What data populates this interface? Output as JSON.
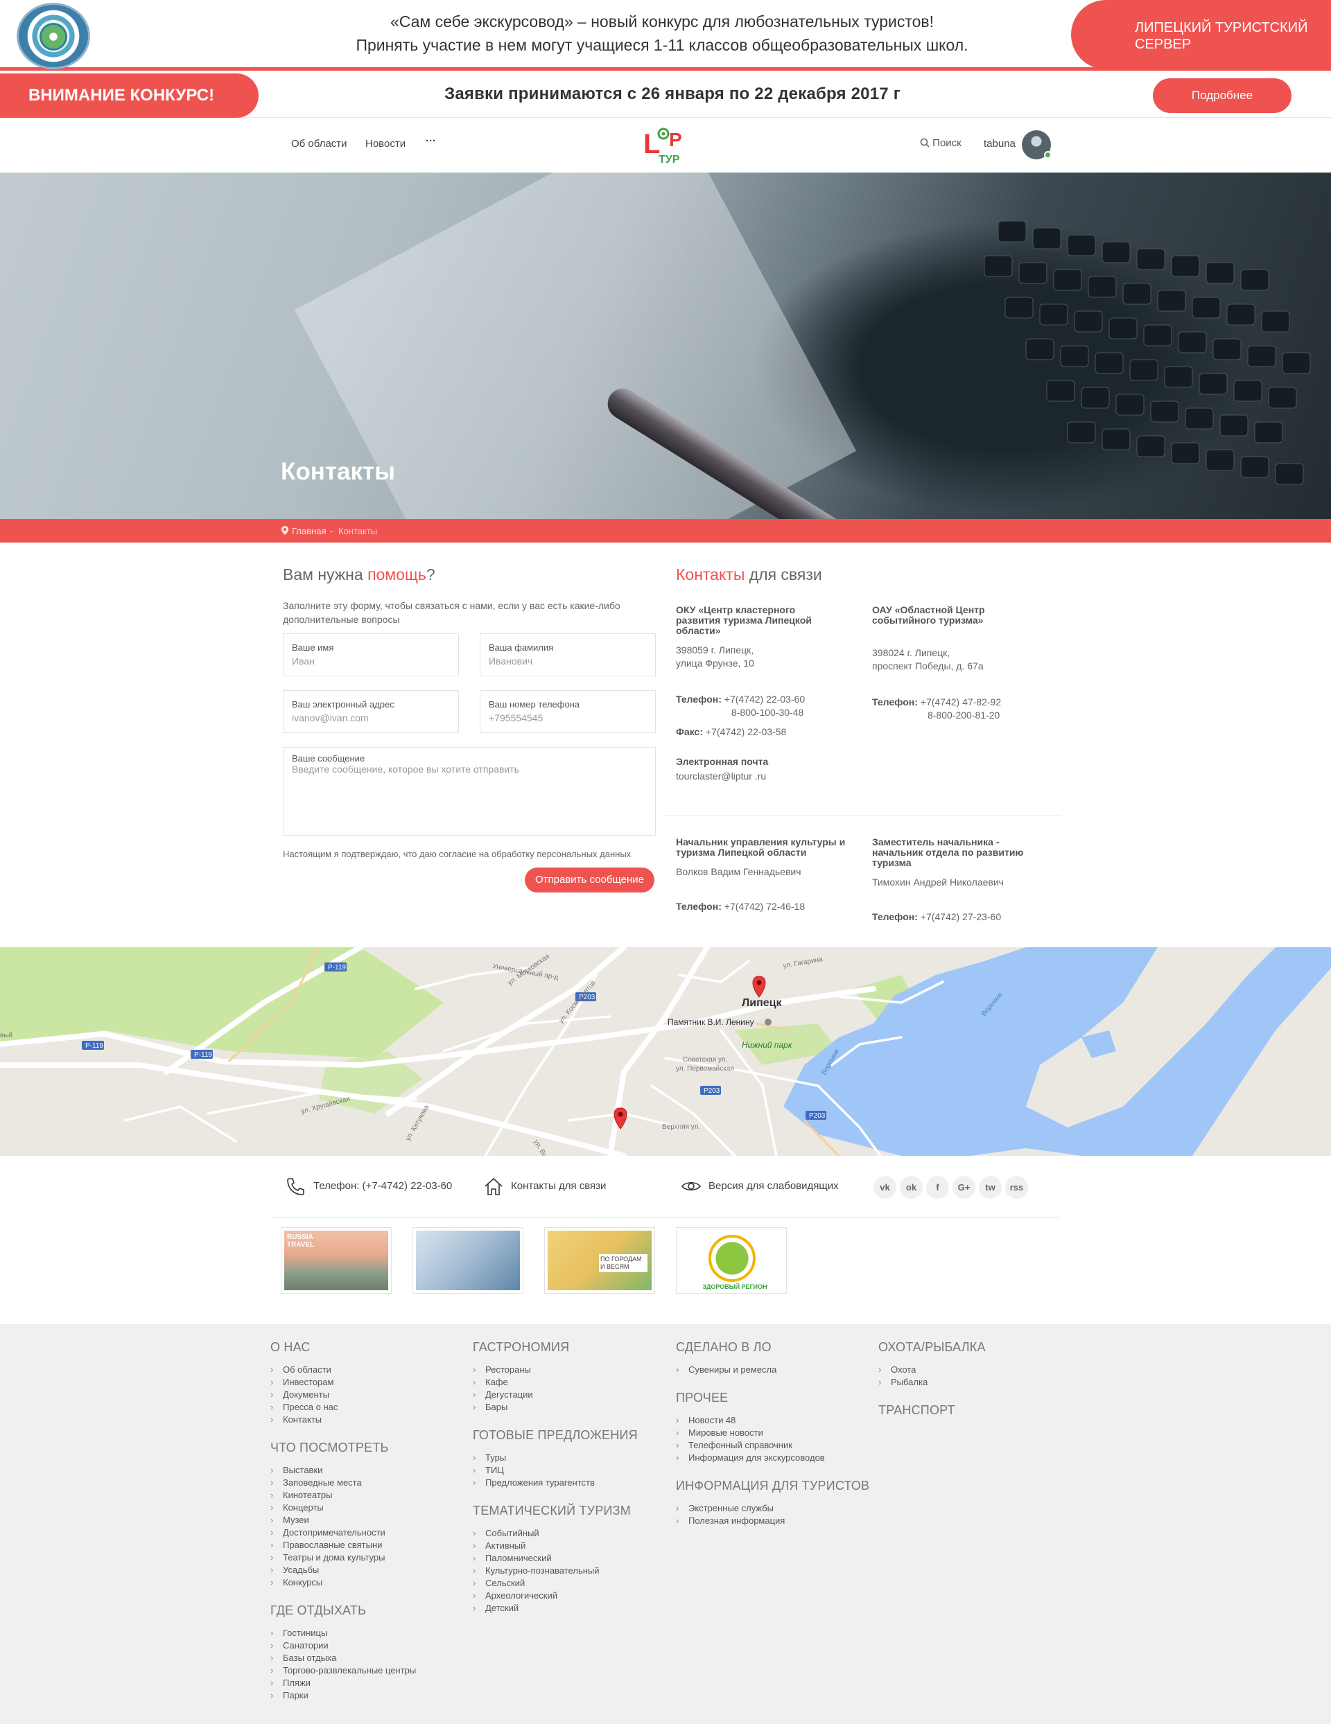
{
  "promo": {
    "line1": "«Сам себе экскурсовод» – новый конкурс для любознательных туристов!",
    "line2": "Принять участие в нем могут учащиеся 1-11 классов общеобразовательных школ.",
    "server_label": "ЛИПЕЦКИЙ ТУРИСТСКИЙ СЕРВЕР"
  },
  "contest": {
    "badge": "ВНИМАНИЕ КОНКУРС!",
    "text": "Заявки принимаются с 26 января по 22 декабря 2017 г",
    "button": "Подробнее"
  },
  "nav": {
    "items": [
      "Об области",
      "Новости"
    ],
    "more": "···",
    "search": "Поиск",
    "user": "tabuna",
    "logo_text": "ТУР"
  },
  "hero": {
    "title": "Контакты"
  },
  "breadcrumb": {
    "home": "Главная",
    "sep": "-",
    "current": "Контакты"
  },
  "form": {
    "title_pre": "Вам нужна ",
    "title_accent": "помощь",
    "title_post": "?",
    "description": "Заполните эту форму, чтобы связаться с нами, если у вас есть какие-либо дополнительные вопросы",
    "fields": [
      {
        "label": "Ваше имя",
        "placeholder": "Иван"
      },
      {
        "label": "Ваша фамилия",
        "placeholder": "Иванович"
      },
      {
        "label": "Ваш электронный адрес",
        "placeholder": "ivanov@ivan.com"
      },
      {
        "label": "Ваш номер телефона",
        "placeholder": "+795554545"
      },
      {
        "label": "Ваше сообщение",
        "placeholder": "Введите сообщение, которое вы хотите отправить"
      }
    ],
    "consent": "Настоящим я подтверждаю, что даю согласие на обработку персональных данных",
    "submit": "Отправить сообщение"
  },
  "contacts": {
    "title_accent": "Контакты",
    "title_post": " для связи",
    "org1": {
      "name": "ОКУ «Центр кластерного развития туризма Липецкой области»",
      "address1": "398059 г. Липецк,",
      "address2": "улица Фрунзе, 10",
      "phone_label": "Телефон:",
      "phone1": "+7(4742) 22-03-60",
      "phone2": "8-800-100-30-48",
      "fax_label": "Факс:",
      "fax": "+7(4742) 22-03-58",
      "email_label": "Электронная почта",
      "email": "tourclaster@liptur .ru"
    },
    "org2": {
      "name": "ОАУ «Областной Центр событийного туризма»",
      "address1": "398024 г. Липецк,",
      "address2": "проспект Победы, д. 67а",
      "phone_label": "Телефон:",
      "phone1": "+7(4742) 47-82-92",
      "phone2": "8-800-200-81-20"
    },
    "person1": {
      "title": "Начальник управления культуры и туризма Липецкой области",
      "name": "Волков Вадим Геннадьевич",
      "phone_label": "Телефон:",
      "phone": "+7(4742) 72-46-18"
    },
    "person2": {
      "title": "Заместитель начальника - начальник отдела по развитию туризма",
      "name": "Тимохин Андрей Николаевич",
      "phone_label": "Телефон:",
      "phone": "+7(4742) 27-23-60"
    }
  },
  "map": {
    "city": "Липецк",
    "monument": "Памятник В.И. Ленину",
    "park": "Нижний парк",
    "roads": [
      "Р-119",
      "Р-119",
      "Р-119",
      "Р203",
      "Р203",
      "Р203"
    ],
    "edge_label": "вый",
    "streets": [
      "ул. Московская",
      "ул. Космонавтов",
      "ул. Гагарина",
      "Советская ул.",
      "ул. Первомайская",
      "Универсальный пр-д",
      "Воронеж",
      "Воронеж",
      "ул. Катукова",
      "Верхняя ул.",
      "ул. Ворошилова",
      "ул. Хрущёвская"
    ]
  },
  "footer": {
    "phone": "Телефон: (+7-4742) 22-03-60",
    "contacts": "Контакты для связи",
    "accessibility": "Версия для слабовидящих",
    "social": [
      "vk",
      "ok",
      "f",
      "G+",
      "tw",
      "rss"
    ],
    "banner_labels": [
      "RUSSIA TRAVEL",
      "ПО ГОРОДАМ И ВЕСЯМ",
      "ЗДОРОВЫЙ РЕГИОН"
    ]
  },
  "sitemap": {
    "col1": [
      {
        "title": "О НАС",
        "items": [
          "Об области",
          "Инвесторам",
          "Документы",
          "Пресса о нас",
          "Контакты"
        ]
      },
      {
        "title": "ЧТО ПОСМОТРЕТЬ",
        "items": [
          "Выставки",
          "Заповедные места",
          "Кинотеатры",
          "Концерты",
          "Музеи",
          "Достопримечательности",
          "Православные святыни",
          "Театры и дома культуры",
          "Усадьбы",
          "Конкурсы"
        ]
      },
      {
        "title": "ГДЕ ОТДЫХАТЬ",
        "items": [
          "Гостиницы",
          "Санатории",
          "Базы отдыха",
          "Торгово-развлекальные центры",
          "Пляжи",
          "Парки"
        ]
      }
    ],
    "col2": [
      {
        "title": "ГАСТРОНОМИЯ",
        "items": [
          "Рестораны",
          "Кафе",
          "Дегустации",
          "Бары"
        ]
      },
      {
        "title": "ГОТОВЫЕ ПРЕДЛОЖЕНИЯ",
        "items": [
          "Туры",
          "ТИЦ",
          "Предложения турагентств"
        ]
      },
      {
        "title": "ТЕМАТИЧЕСКИЙ ТУРИЗМ",
        "items": [
          "Событийный",
          "Активный",
          "Паломнический",
          "Культурно-познавательный",
          "Сельский",
          "Археологический",
          "Детский"
        ]
      }
    ],
    "col3": [
      {
        "title": "СДЕЛАНО В ЛО",
        "items": [
          "Сувениры и ремесла"
        ]
      },
      {
        "title": "ПРОЧЕЕ",
        "items": [
          "Новости 48",
          "Мировые новости",
          "Телефонный справочник",
          "Информация для экскурсоводов"
        ]
      },
      {
        "title": "ИНФОРМАЦИЯ ДЛЯ ТУРИСТОВ",
        "items": [
          "Экстренные службы",
          "Полезная информация"
        ]
      }
    ],
    "col4": [
      {
        "title": "ОХОТА/РЫБАЛКА",
        "items": [
          "Охота",
          "Рыбалка"
        ]
      },
      {
        "title": "ТРАНСПОРТ",
        "items": []
      }
    ]
  },
  "colors": {
    "accent": "#ef5350",
    "footer_bg": "#eef0f1"
  }
}
